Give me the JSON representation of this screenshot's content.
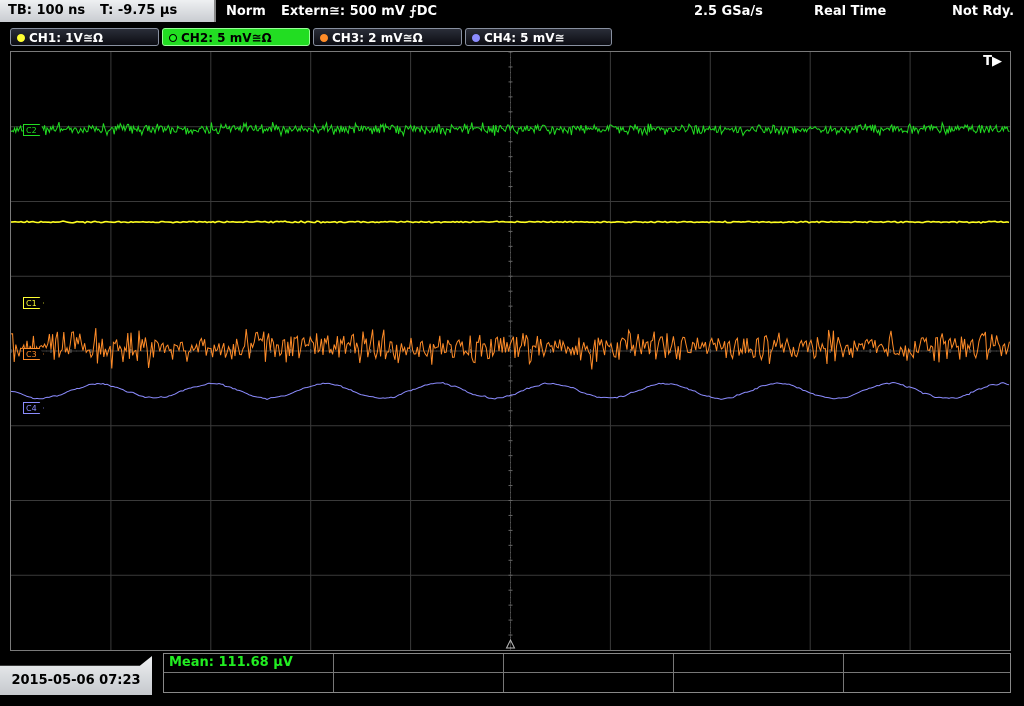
{
  "topbar": {
    "timebase": "TB: 100 ns",
    "trigger_time": "T: -9.75 µs",
    "mode": "Norm",
    "trigger_source": "Extern≅: 500 mV ⨍DC",
    "sample_rate": "2.5 GSa/s",
    "acq_mode": "Real Time",
    "status": "Not Rdy."
  },
  "channels": [
    {
      "label": "CH1: 1V≅Ω",
      "color": "#ffff33"
    },
    {
      "label": "CH2: 5 mV≅Ω",
      "color": "#22ee22"
    },
    {
      "label": "CH3: 2 mV≅Ω",
      "color": "#ff8c28"
    },
    {
      "label": "CH4: 5 mV≅",
      "color": "#8c8cff"
    }
  ],
  "markers": {
    "trigger": "T▶",
    "c1": "C1",
    "c2": "C2",
    "c3": "C3",
    "c4": "C4"
  },
  "measurement": {
    "label": "Mean: 111.68 µV"
  },
  "datetime": "2015-05-06 07:23"
}
